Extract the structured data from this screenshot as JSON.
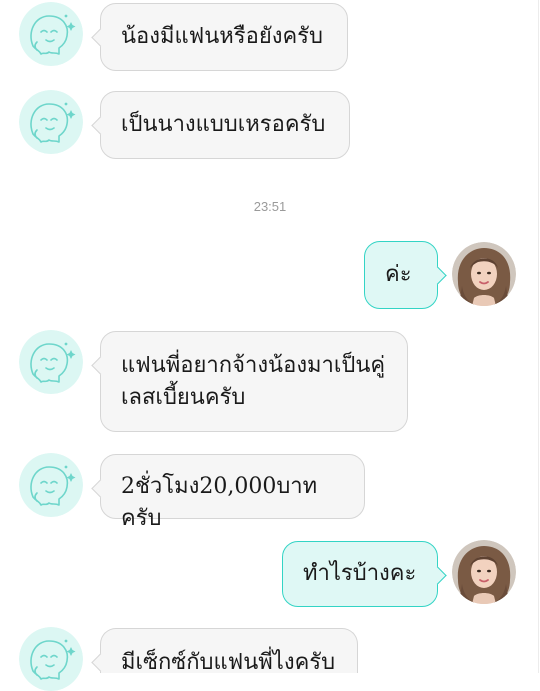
{
  "chat": {
    "timestamp": "23:51",
    "messages": [
      {
        "sender": "other",
        "text": "น้องมีแฟนหรือยังครับ",
        "avatar": "bot-ghost-avatar"
      },
      {
        "sender": "other",
        "text": "เป็นนางแบบเหรอครับ",
        "avatar": "bot-ghost-avatar"
      },
      {
        "sender": "me",
        "text": "ค่ะ",
        "avatar": "user-photo-avatar"
      },
      {
        "sender": "other",
        "text": "แฟนพี่อยากจ้างน้องมาเป็นคู่\nเลสเบี้ยนครับ",
        "avatar": "bot-ghost-avatar"
      },
      {
        "sender": "other",
        "text": "2ชั่วโมง20,000บาทครับ",
        "avatar": "bot-ghost-avatar"
      },
      {
        "sender": "me",
        "text": "ทำไรบ้างคะ",
        "avatar": "user-photo-avatar"
      },
      {
        "sender": "other",
        "text": "มีเซ็กซ์กับแฟนพี่ไงครับ",
        "avatar": "bot-ghost-avatar"
      }
    ]
  },
  "colors": {
    "incoming_bubble": "#f6f6f6",
    "incoming_border": "#d6d6d6",
    "outgoing_bubble": "#dff8f5",
    "outgoing_border": "#33d4c5",
    "bot_avatar_bg": "#dcf7f3",
    "timestamp": "#9a9a9a"
  }
}
